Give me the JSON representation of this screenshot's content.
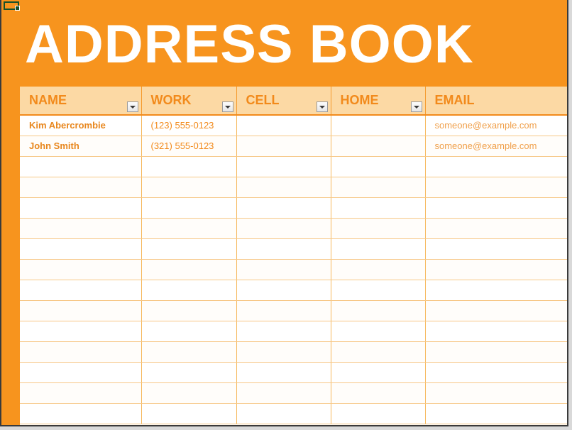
{
  "document": {
    "title": "ADDRESS BOOK",
    "accent_color": "#F7941E",
    "header_bg_color": "#FCD9A4",
    "header_text_color": "#F28A1B",
    "body_text_color": "#F28A1B",
    "page_bg_color": "#FFFFFF"
  },
  "active_cell": {
    "name": "active-cell-marker",
    "border_color": "#17502A"
  },
  "table": {
    "columns": [
      {
        "label": "NAME",
        "has_filter": true,
        "filter_icon": "chevron-down-icon"
      },
      {
        "label": "WORK",
        "has_filter": true,
        "filter_icon": "chevron-down-icon"
      },
      {
        "label": "CELL",
        "has_filter": true,
        "filter_icon": "chevron-down-icon"
      },
      {
        "label": "HOME",
        "has_filter": true,
        "filter_icon": "chevron-down-icon"
      },
      {
        "label": "EMAIL",
        "has_filter": false,
        "filter_icon": ""
      }
    ],
    "rows": [
      {
        "name": "Kim Abercrombie",
        "work": "(123) 555-0123",
        "cell": "",
        "home": "",
        "email": "someone@example.com"
      },
      {
        "name": "John Smith",
        "work": "(321) 555-0123",
        "cell": "",
        "home": "",
        "email": "someone@example.com"
      },
      {
        "name": "",
        "work": "",
        "cell": "",
        "home": "",
        "email": ""
      },
      {
        "name": "",
        "work": "",
        "cell": "",
        "home": "",
        "email": ""
      },
      {
        "name": "",
        "work": "",
        "cell": "",
        "home": "",
        "email": ""
      },
      {
        "name": "",
        "work": "",
        "cell": "",
        "home": "",
        "email": ""
      },
      {
        "name": "",
        "work": "",
        "cell": "",
        "home": "",
        "email": ""
      },
      {
        "name": "",
        "work": "",
        "cell": "",
        "home": "",
        "email": ""
      },
      {
        "name": "",
        "work": "",
        "cell": "",
        "home": "",
        "email": ""
      },
      {
        "name": "",
        "work": "",
        "cell": "",
        "home": "",
        "email": ""
      },
      {
        "name": "",
        "work": "",
        "cell": "",
        "home": "",
        "email": ""
      },
      {
        "name": "",
        "work": "",
        "cell": "",
        "home": "",
        "email": ""
      },
      {
        "name": "",
        "work": "",
        "cell": "",
        "home": "",
        "email": ""
      },
      {
        "name": "",
        "work": "",
        "cell": "",
        "home": "",
        "email": ""
      },
      {
        "name": "",
        "work": "",
        "cell": "",
        "home": "",
        "email": ""
      }
    ]
  }
}
